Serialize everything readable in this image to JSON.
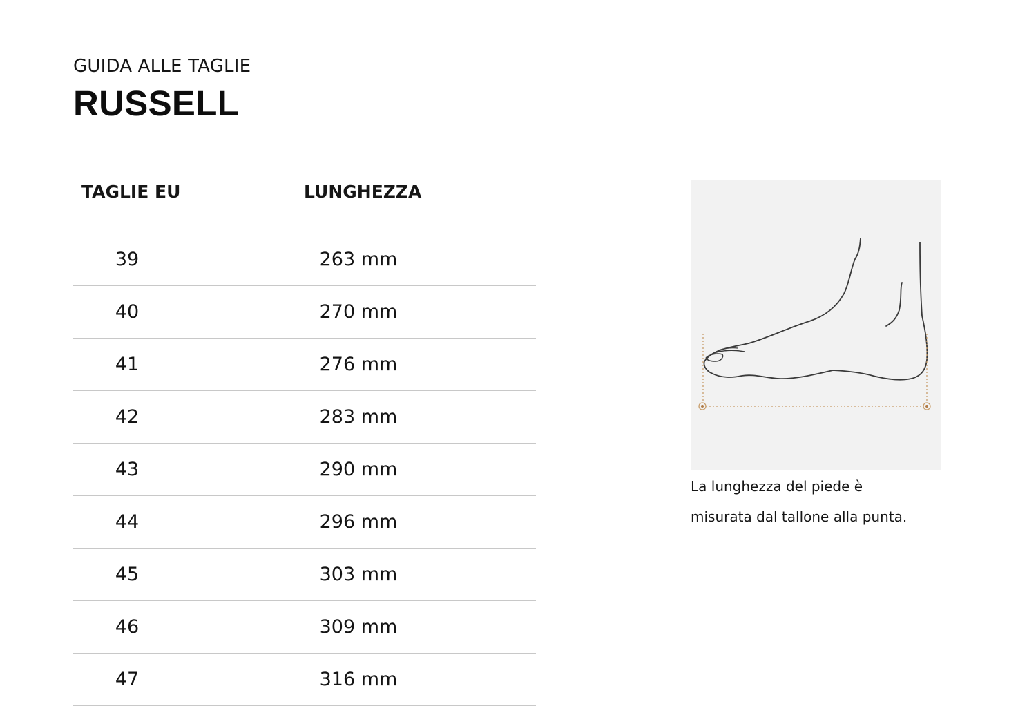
{
  "header": {
    "subtitle": "GUIDA ALLE TAGLIE",
    "title": "RUSSELL"
  },
  "table": {
    "columns": [
      "TAGLIE EU",
      "LUNGHEZZA"
    ],
    "rows": [
      {
        "size": "39",
        "length": "263 mm"
      },
      {
        "size": "40",
        "length": "270 mm"
      },
      {
        "size": "41",
        "length": "276 mm"
      },
      {
        "size": "42",
        "length": "283 mm"
      },
      {
        "size": "43",
        "length": "290 mm"
      },
      {
        "size": "44",
        "length": "296 mm"
      },
      {
        "size": "45",
        "length": "303 mm"
      },
      {
        "size": "46",
        "length": "309 mm"
      },
      {
        "size": "47",
        "length": "316 mm"
      }
    ]
  },
  "figure": {
    "icon": "foot-length-diagram-icon",
    "background": "#f2f2f2",
    "measure_color": "#c89d6a",
    "caption_line1": "La lunghezza del piede è",
    "caption_line2": "misurata dal tallone alla punta."
  }
}
